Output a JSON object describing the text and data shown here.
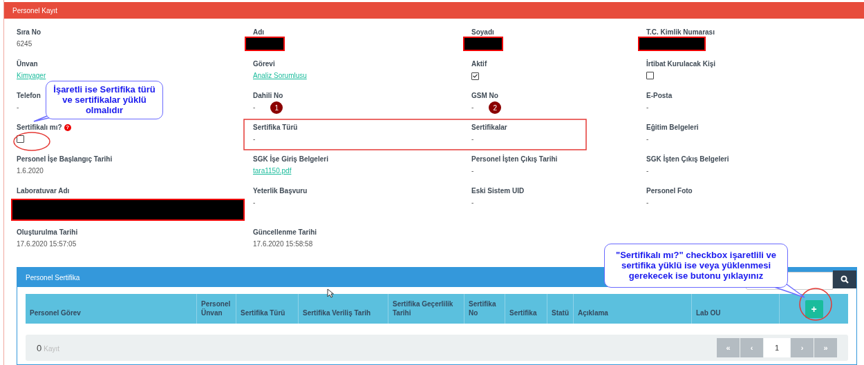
{
  "header": {
    "title": "Personel Kayıt"
  },
  "fields": [
    {
      "label": "Sıra No",
      "kind": "text",
      "value": "6245"
    },
    {
      "label": "Adı",
      "kind": "redacted_short"
    },
    {
      "label": "Soyadı",
      "kind": "redacted_short"
    },
    {
      "label": "T.C. Kimlik Numarası",
      "kind": "redacted_medium"
    },
    {
      "label": "Ünvan",
      "kind": "link",
      "value": "Kimyager"
    },
    {
      "label": "Görevi",
      "kind": "link",
      "value": "Analiz Sorumlusu"
    },
    {
      "label": "Aktif",
      "kind": "checkbox",
      "checked": true
    },
    {
      "label": "İrtibat Kurulacak Kişi",
      "kind": "checkbox",
      "checked": false
    },
    {
      "label": "Telefon",
      "kind": "text",
      "value": "-"
    },
    {
      "label": "Dahili No",
      "kind": "text",
      "value": "-",
      "marker": "1"
    },
    {
      "label": "GSM No",
      "kind": "text",
      "value": "-",
      "marker": "2"
    },
    {
      "label": "E-Posta",
      "kind": "text",
      "value": "-"
    },
    {
      "label": "Sertifikalı mı?",
      "kind": "checkbox",
      "checked": false,
      "help": "?"
    },
    {
      "label": "Sertifika Türü",
      "kind": "text",
      "value": "-"
    },
    {
      "label": "Sertifikalar",
      "kind": "text",
      "value": "-"
    },
    {
      "label": "Eğitim Belgeleri",
      "kind": "text",
      "value": "-"
    },
    {
      "label": "Personel İşe Başlangıç Tarihi",
      "kind": "text",
      "value": "1.6.2020"
    },
    {
      "label": "SGK İşe Giriş Belgeleri",
      "kind": "link",
      "value": "tara1150.pdf"
    },
    {
      "label": "Personel İşten Çıkış Tarihi",
      "kind": "text",
      "value": "-"
    },
    {
      "label": "SGK İşten Çıkış Belgeleri",
      "kind": "text",
      "value": "-"
    },
    {
      "label": "Laboratuvar Adı",
      "kind": "redacted_wide"
    },
    {
      "label": "Yeterlik Başvuru",
      "kind": "text",
      "value": "-"
    },
    {
      "label": "Eski Sistem UID",
      "kind": "text",
      "value": "-"
    },
    {
      "label": "Personel Foto",
      "kind": "text",
      "value": "-"
    },
    {
      "label": "Oluşturulma Tarihi",
      "kind": "text",
      "value": "17.6.2020 15:57:05"
    },
    {
      "label": "Güncellenme Tarihi",
      "kind": "text",
      "value": "17.6.2020 15:58:58"
    }
  ],
  "certificates": {
    "title": "Personel Sertifika",
    "columns": [
      "Personel Görev",
      "Personel Ünvan",
      "Sertifika Türü",
      "Sertifika Veriliş Tarih",
      "Sertifika Geçerlilik Tarihi",
      "Sertifika No",
      "Sertifika",
      "Statü",
      "Açıklama",
      "Lab OU"
    ],
    "add_button": "+",
    "record_count": "0",
    "record_label": "Kayıt",
    "pagination": [
      {
        "label": "«",
        "kind": "nav",
        "selected": false
      },
      {
        "label": "‹",
        "kind": "nav",
        "selected": false
      },
      {
        "label": "1",
        "kind": "page",
        "selected": true
      },
      {
        "label": "›",
        "kind": "nav",
        "selected": false
      },
      {
        "label": "»",
        "kind": "nav",
        "selected": false
      }
    ]
  },
  "callouts": [
    {
      "text": "İşaretli ise Sertifika türü ve sertifikalar yüklü olmalıdır"
    },
    {
      "text": "\"Sertifikalı mı?\" checkbox işaretlili ve sertifika yüklü ise veya yüklenmesi gerekecek ise butonu yıklayınız"
    }
  ]
}
